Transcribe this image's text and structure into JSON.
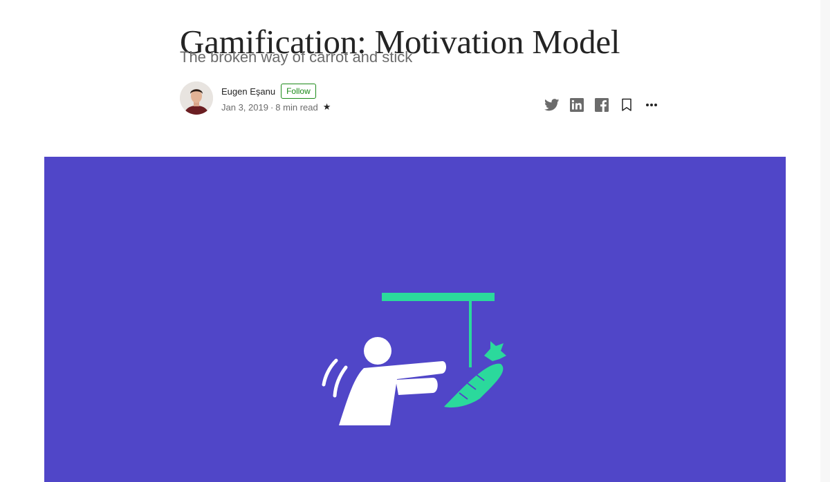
{
  "article": {
    "title": "Gamification: Motivation Model",
    "subtitle": "The broken way of carrot and stick"
  },
  "author": {
    "name": "Eugen Eşanu",
    "follow_label": "Follow",
    "date": "Jan 3, 2019",
    "separator": "·",
    "read_time": "8 min read",
    "member_star": "★"
  },
  "actions": {
    "icons": [
      "twitter-icon",
      "linkedin-icon",
      "facebook-icon",
      "bookmark-icon",
      "more-icon"
    ],
    "more_glyph": "•••"
  },
  "hero": {
    "background": "#5046c8",
    "accent": "#2bd99c",
    "figure": "#ffffff"
  },
  "colors": {
    "text_primary": "#242424",
    "text_secondary": "#6b6b6b",
    "follow_green": "#1a8917"
  }
}
